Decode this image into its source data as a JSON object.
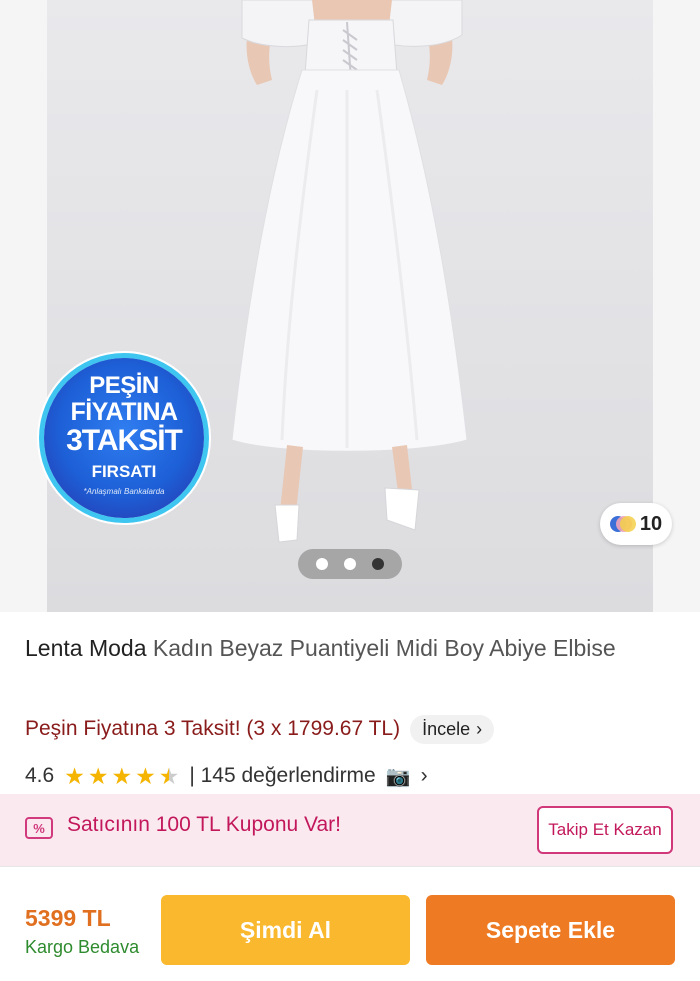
{
  "gallery": {
    "badge": {
      "line1": "PEŞİN",
      "line2": "FİYATINA",
      "line3": "3TAKSİT",
      "line4": "FIRSATI",
      "line5": "*Anlaşmalı Bankalarda"
    },
    "photo_count": "10",
    "pages": 3,
    "active_page": 3
  },
  "product": {
    "brand": "Lenta Moda",
    "name": "Kadın Beyaz Puantiyeli Midi Boy Abiye Elbise",
    "installment_text": "Peşin Fiyatına 3 Taksit! (3 x 1799.67 TL)",
    "incele_label": "İncele",
    "rating": "4.6",
    "rating_value": 4.6,
    "review_count": "| 145 değerlendirme"
  },
  "coupon": {
    "icon": "coupon-percent-icon",
    "text": "Satıcının 100 TL Kuponu Var!",
    "follow_label": "Takip Et Kazan"
  },
  "bottom_bar": {
    "price": "5399 TL",
    "shipping": "Kargo Bedava",
    "buy_now_label": "Şimdi Al",
    "add_to_cart_label": "Sepete Ekle"
  },
  "colors": {
    "installment_text": "#8a1b1b",
    "coupon_background": "#fbe9f0",
    "coupon_accent": "#c2185b",
    "price": "#e07020",
    "shipping": "#2e8b2e",
    "buy_now": "#f9b82d",
    "add_to_cart": "#ee7a23",
    "star": "#f4b400"
  }
}
